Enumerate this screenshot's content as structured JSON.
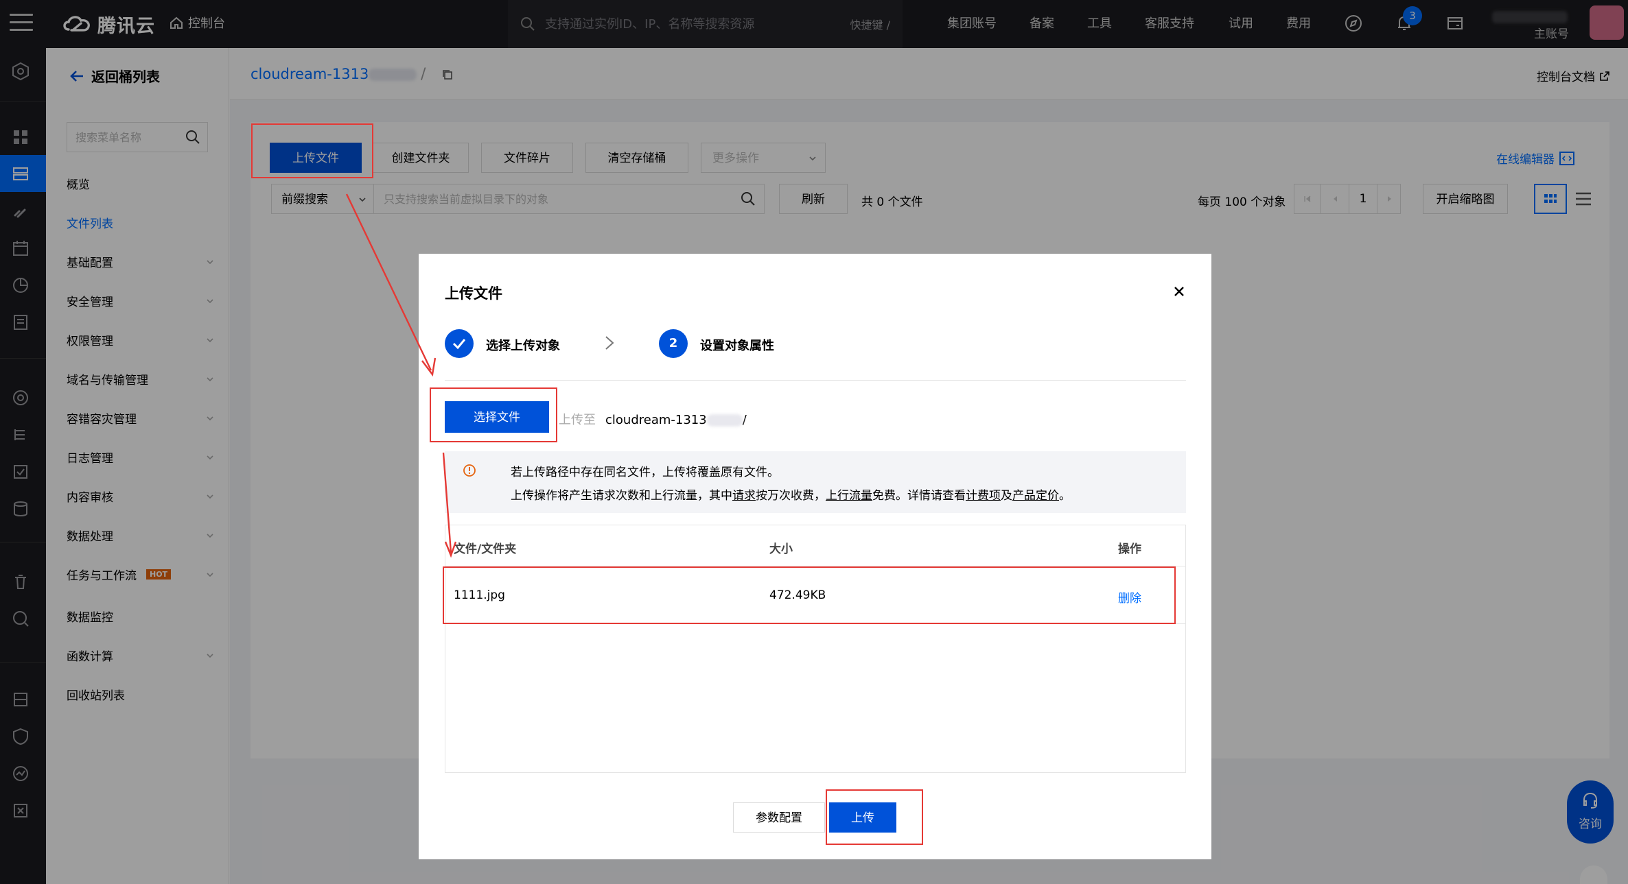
{
  "topbar": {
    "brand": "腾讯云",
    "console": "控制台",
    "search_placeholder": "支持通过实例ID、IP、名称等搜索资源",
    "shortcut": "快捷键 /",
    "nav": [
      "集团账号",
      "备案",
      "工具",
      "客服支持",
      "试用",
      "费用"
    ],
    "notification_count": "3",
    "account_label": "主账号"
  },
  "sidebar": {
    "back": "返回桶列表",
    "search_placeholder": "搜索菜单名称",
    "items": [
      {
        "label": "概览",
        "expandable": false
      },
      {
        "label": "文件列表",
        "expandable": false,
        "selected": true
      },
      {
        "label": "基础配置",
        "expandable": true
      },
      {
        "label": "安全管理",
        "expandable": true
      },
      {
        "label": "权限管理",
        "expandable": true
      },
      {
        "label": "域名与传输管理",
        "expandable": true
      },
      {
        "label": "容错容灾管理",
        "expandable": true
      },
      {
        "label": "日志管理",
        "expandable": true
      },
      {
        "label": "内容审核",
        "expandable": true
      },
      {
        "label": "数据处理",
        "expandable": true
      },
      {
        "label": "任务与工作流",
        "expandable": true,
        "badge": "HOT"
      },
      {
        "label": "数据监控",
        "expandable": false
      },
      {
        "label": "函数计算",
        "expandable": true
      },
      {
        "label": "回收站列表",
        "expandable": false
      }
    ]
  },
  "breadcrumb": {
    "bucket": "cloudream-1313",
    "separator": "/",
    "docs": "控制台文档"
  },
  "toolbar": {
    "upload": "上传文件",
    "create_folder": "创建文件夹",
    "fragments": "文件碎片",
    "empty_bucket": "清空存储桶",
    "more": "更多操作",
    "online_editor": "在线编辑器"
  },
  "filter": {
    "prefix": "前缀搜索",
    "search_placeholder": "只支持搜索当前虚拟目录下的对象",
    "refresh": "刷新",
    "total": "共 0 个文件",
    "per_page": "每页 100 个对象",
    "page": "1",
    "thumbnail": "开启缩略图"
  },
  "modal": {
    "title": "上传文件",
    "step1": "选择上传对象",
    "step2_num": "2",
    "step2": "设置对象属性",
    "select_file": "选择文件",
    "upload_to": "上传至",
    "upload_path": "cloudream-1313",
    "upload_path_tail": "/",
    "notice_line1": "若上传路径中存在同名文件，上传将覆盖原有文件。",
    "notice_line2_a": "上传操作将产生请求次数和上行流量，其中",
    "notice_link_requests": "请求",
    "notice_line2_b": "按万次收费，",
    "notice_link_traffic": "上行流量",
    "notice_line2_c": "免费。详情请查看",
    "notice_link_billing": "计费项",
    "notice_line2_d": "及",
    "notice_link_pricing": "产品定价",
    "notice_line2_e": "。",
    "columns": {
      "name": "文件/文件夹",
      "size": "大小",
      "action": "操作"
    },
    "files": [
      {
        "name": "1111.jpg",
        "size": "472.49KB",
        "action": "删除"
      }
    ],
    "params_button": "参数配置",
    "upload_button": "上传"
  },
  "consult": "咨询",
  "colors": {
    "brand_blue": "#0052d9",
    "link_blue": "#006eff",
    "annotation_red": "#e53935",
    "topbar": "#1b1b1f"
  }
}
